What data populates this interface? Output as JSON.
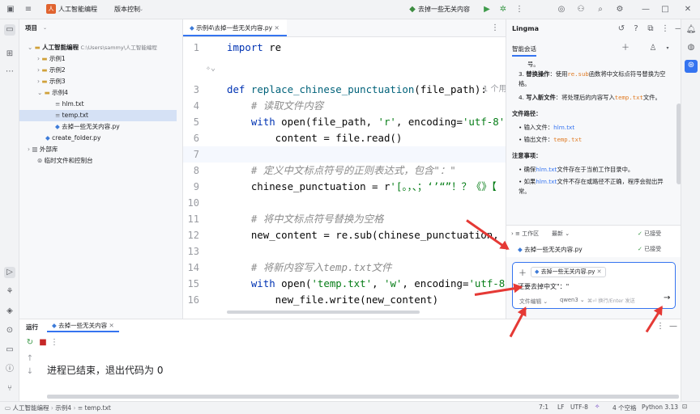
{
  "titlebar": {
    "project_badge": "人",
    "project_name": "人工智能编程",
    "vcs_label": "版本控制",
    "run_config": "去掉一些无关内容"
  },
  "project_panel": {
    "title": "项目",
    "root_name": "人工智能编程",
    "root_path": "C:\\Users\\sammy\\人工智能编程",
    "items": [
      {
        "label": "示例1"
      },
      {
        "label": "示例2"
      },
      {
        "label": "示例3"
      },
      {
        "label": "示例4"
      },
      {
        "label": "hlm.txt"
      },
      {
        "label": "temp.txt"
      },
      {
        "label": "去掉一些无关内容.py"
      },
      {
        "label": "create_folder.py"
      },
      {
        "label": "外部库"
      },
      {
        "label": "临时文件和控制台"
      }
    ]
  },
  "editor": {
    "tab_label": "示例4\\去掉一些无关内容.py",
    "inlay_hint": "1 个用",
    "lines": [
      {
        "n": "1",
        "code": "import re"
      },
      {
        "n": "",
        "code": ""
      },
      {
        "n": "3",
        "code": "def replace_chinese_punctuation(file_path):"
      },
      {
        "n": "4",
        "code": "    # 读取文件内容"
      },
      {
        "n": "5",
        "code": "    with open(file_path, 'r', encoding='utf-8')"
      },
      {
        "n": "6",
        "code": "        content = file.read()"
      },
      {
        "n": "7",
        "code": ""
      },
      {
        "n": "8",
        "code": "    # 定义中文标点符号的正则表达式，包含\"：\""
      },
      {
        "n": "9",
        "code": "    chinese_punctuation = r'[。，、；‘’“”！？《》【"
      },
      {
        "n": "10",
        "code": ""
      },
      {
        "n": "11",
        "code": "    # 将中文标点符号替换为空格"
      },
      {
        "n": "12",
        "code": "    new_content = re.sub(chinese_punctuation,"
      },
      {
        "n": "13",
        "code": ""
      },
      {
        "n": "14",
        "code": "    # 将新内容写入temp.txt文件"
      },
      {
        "n": "15",
        "code": "    with open('temp.txt', 'w', encoding='utf-8')"
      },
      {
        "n": "16",
        "code": "        new_file.write(new_content)"
      }
    ]
  },
  "lingma": {
    "title": "Lingma",
    "tab": "智能会话",
    "doc": {
      "cont": "号。",
      "step3_title": "替换操作",
      "step3_a": "：使用",
      "step3_code": "re.sub",
      "step3_b": "函数将中文标点符号替换为空格。",
      "step4_title": "写入新文件",
      "step4_a": "：将处理后的内容写入",
      "step4_code": "temp.txt",
      "step4_b": "文件。",
      "paths_heading": "文件路径：",
      "in_a": "输入文件：",
      "in_file": "hlm.txt",
      "out_a": "输出文件：",
      "out_file": "temp.txt",
      "notes_heading": "注意事项：",
      "n1_a": "确保",
      "n1_file": "hlm.txt",
      "n1_b": "文件存在于当前工作目录中。",
      "n2_a": "如果",
      "n2_file": "hlm.txt",
      "n2_b": "文件不存在或路径不正确，程序会抛出异常。"
    },
    "workspace": {
      "label": "工作区",
      "sort": "最新",
      "accepted_top": "已接受",
      "file": "去掉一些无关内容.py",
      "accepted": "已接受"
    },
    "input": {
      "context_file": "去掉一些无关内容.py",
      "text": "还要去掉中文\"：\"",
      "mode": "文件编辑",
      "model": "qwen3",
      "hint": "⌘⏎ 换行/Enter 发送"
    }
  },
  "run_panel": {
    "tab_title": "运行",
    "run_tab": "去掉一些无关内容",
    "output": "进程已结束，退出代码为 0"
  },
  "statusbar": {
    "crumb1": "人工智能编程",
    "crumb2": "示例4",
    "crumb3": "temp.txt",
    "position": "7:1",
    "line_sep": "LF",
    "encoding": "UTF-8",
    "indent": "4 个空格",
    "python": "Python 3.13"
  }
}
